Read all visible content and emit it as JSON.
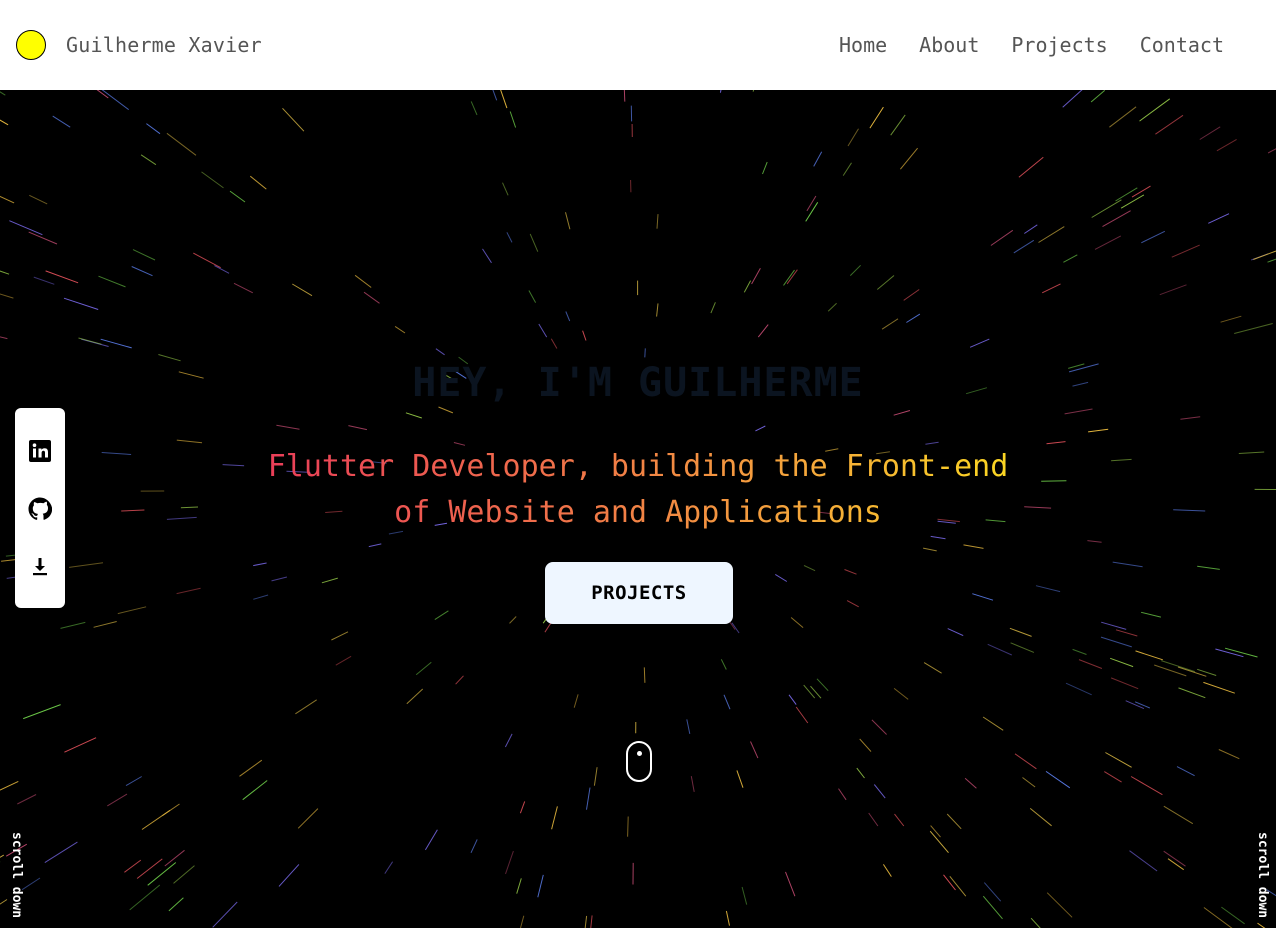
{
  "navbar": {
    "brand": "Guilherme Xavier",
    "logo_color": "#ffff00",
    "links": [
      {
        "label": "Home"
      },
      {
        "label": "About"
      },
      {
        "label": "Projects"
      },
      {
        "label": "Contact"
      }
    ]
  },
  "hero": {
    "title": "HEY, I'M GUILHERME",
    "subtitle_line1": "Flutter Developer, building the Front-end",
    "subtitle_line2": "of Website and Applications",
    "button_label": "PROJECTS",
    "scroll_label": "scroll down",
    "gradient_colors": [
      "#e8325c",
      "#f0704a",
      "#f5a93a",
      "#fde61a"
    ]
  },
  "social": {
    "icons": [
      "linkedin-icon",
      "github-icon",
      "download-icon"
    ]
  }
}
